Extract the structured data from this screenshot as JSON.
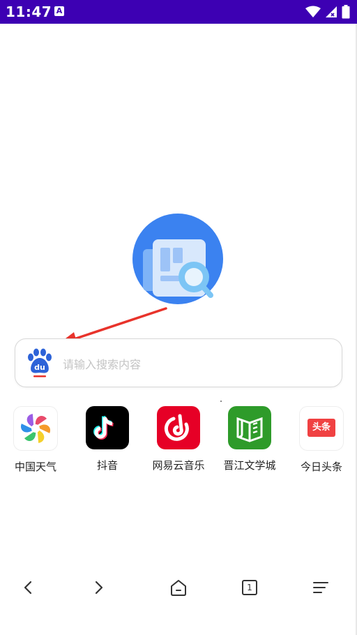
{
  "status_bar": {
    "time": "11:47",
    "notification_icon": "a-icon",
    "wifi_icon": "wifi-icon",
    "signal_icon": "signal-icon",
    "battery_icon": "battery-icon",
    "background_color": "#3d00b3"
  },
  "logo": {
    "icon": "news-search-icon",
    "accent": "#3b82f0"
  },
  "search": {
    "engine_icon": "baidu-icon",
    "placeholder": "请输入搜索内容"
  },
  "annotation": {
    "icon": "red-arrow-icon",
    "color": "#e8332b"
  },
  "shortcuts": [
    {
      "label": "中国天气",
      "icon": "china-weather-icon"
    },
    {
      "label": "抖音",
      "icon": "douyin-icon"
    },
    {
      "label": "网易云音乐",
      "icon": "netease-music-icon"
    },
    {
      "label": "晋江文学城",
      "icon": "jinjiang-icon"
    },
    {
      "label": "今日头条",
      "icon": "toutiao-icon",
      "badge_text": "头条"
    }
  ],
  "bottom_nav": {
    "back_icon": "chevron-left-icon",
    "forward_icon": "chevron-right-icon",
    "home_icon": "home-icon",
    "tabs_count": "1",
    "menu_icon": "menu-icon"
  }
}
